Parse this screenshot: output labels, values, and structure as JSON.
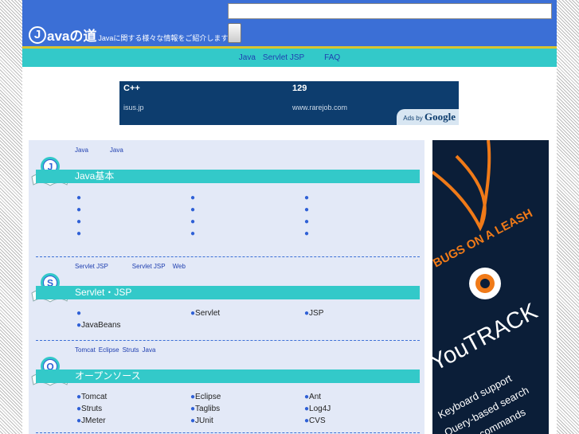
{
  "header": {
    "logo_mark": "J",
    "logo_text": "avaの道",
    "logo_sub": "Javaに関する様々な情報をご紹介します。",
    "search_value": ""
  },
  "nav": {
    "items": [
      "Java",
      "Servlet JSP",
      "FAQ"
    ]
  },
  "ad": {
    "title1": "C++",
    "title2": "129",
    "url1": "isus.jp",
    "url2": "www.rarejob.com",
    "adsby": "Ads by",
    "google": "Google"
  },
  "sections": [
    {
      "icon_letter": "J",
      "sub": [
        "Java",
        "Java"
      ],
      "title": "Java基本",
      "items": [
        "",
        "",
        "",
        "",
        "",
        "",
        "",
        "",
        "",
        "",
        "",
        ""
      ]
    },
    {
      "icon_letter": "S",
      "sub": [
        "Servlet JSP",
        "Servlet JSP",
        "Web"
      ],
      "title": "Servlet・JSP",
      "items": [
        "",
        "Servlet",
        "JSP",
        "JavaBeans"
      ]
    },
    {
      "icon_letter": "O",
      "sub": [
        "Tomcat",
        "Eclipse",
        "Struts",
        "Java"
      ],
      "title": "オープンソース",
      "items": [
        "Tomcat",
        "Eclipse",
        "Ant",
        "Struts",
        "Taglibs",
        "Log4J",
        "JMeter",
        "JUnit",
        "CVS"
      ]
    }
  ],
  "banner": {
    "line1": "BUGS ON A LEASH",
    "brand": "YouTRACK",
    "features": [
      "Keyboard support",
      "Query-based search",
      "Smart commands"
    ],
    "colors": {
      "accent": "#f07a18",
      "background": "#0b1e38"
    }
  },
  "colors": {
    "header": "#3b6fd6",
    "navbar": "#33c9c9",
    "nav_border": "#d8c430",
    "ad_bg": "#0d3d6e",
    "content_bg": "#e3e9f7"
  }
}
